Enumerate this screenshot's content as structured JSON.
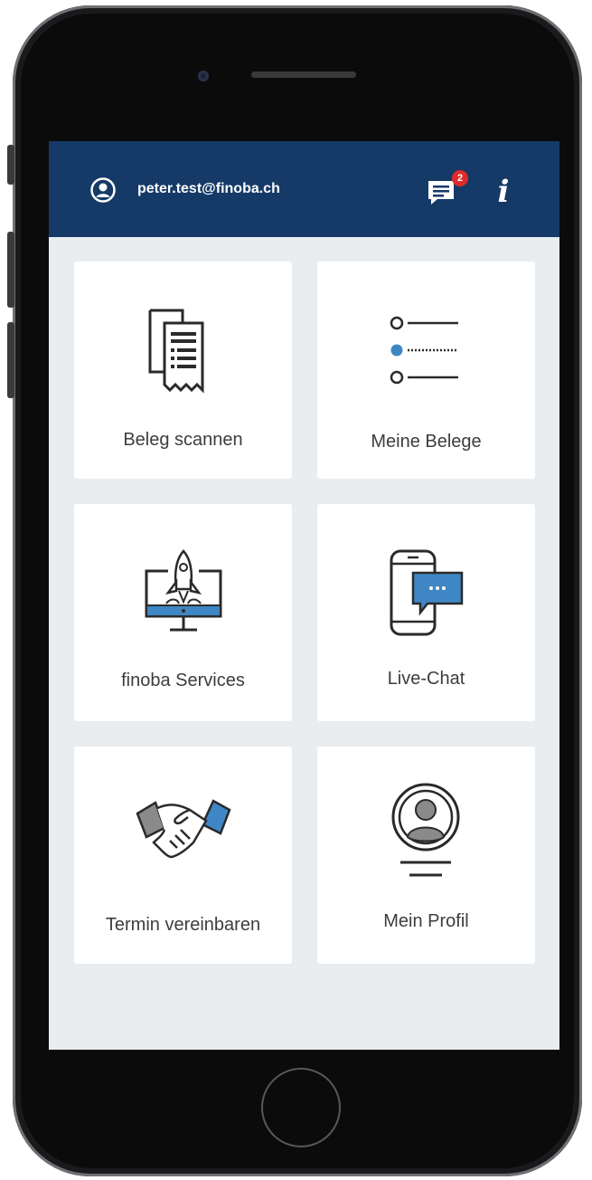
{
  "header": {
    "user_icon": "user-circle-icon",
    "email": "peter.test@finoba.ch",
    "chat_icon": "chat-bubble-icon",
    "chat_badge_count": "2",
    "info_icon": "info-icon",
    "info_glyph": "i",
    "colors": {
      "bar": "#153a67",
      "badge": "#e02a2a"
    }
  },
  "tiles": [
    {
      "label": "Beleg scannen",
      "icon": "receipt-scan-icon"
    },
    {
      "label": "Meine Belege",
      "icon": "list-icon"
    },
    {
      "label": "finoba Services",
      "icon": "rocket-monitor-icon"
    },
    {
      "label": "Live-Chat",
      "icon": "phone-chat-icon"
    },
    {
      "label": "Termin vereinbaren",
      "icon": "handshake-icon"
    },
    {
      "label": "Mein Profil",
      "icon": "profile-icon"
    }
  ],
  "colors": {
    "accent": "#3f86c4",
    "background": "#e9edf0",
    "tile": "#ffffff"
  }
}
